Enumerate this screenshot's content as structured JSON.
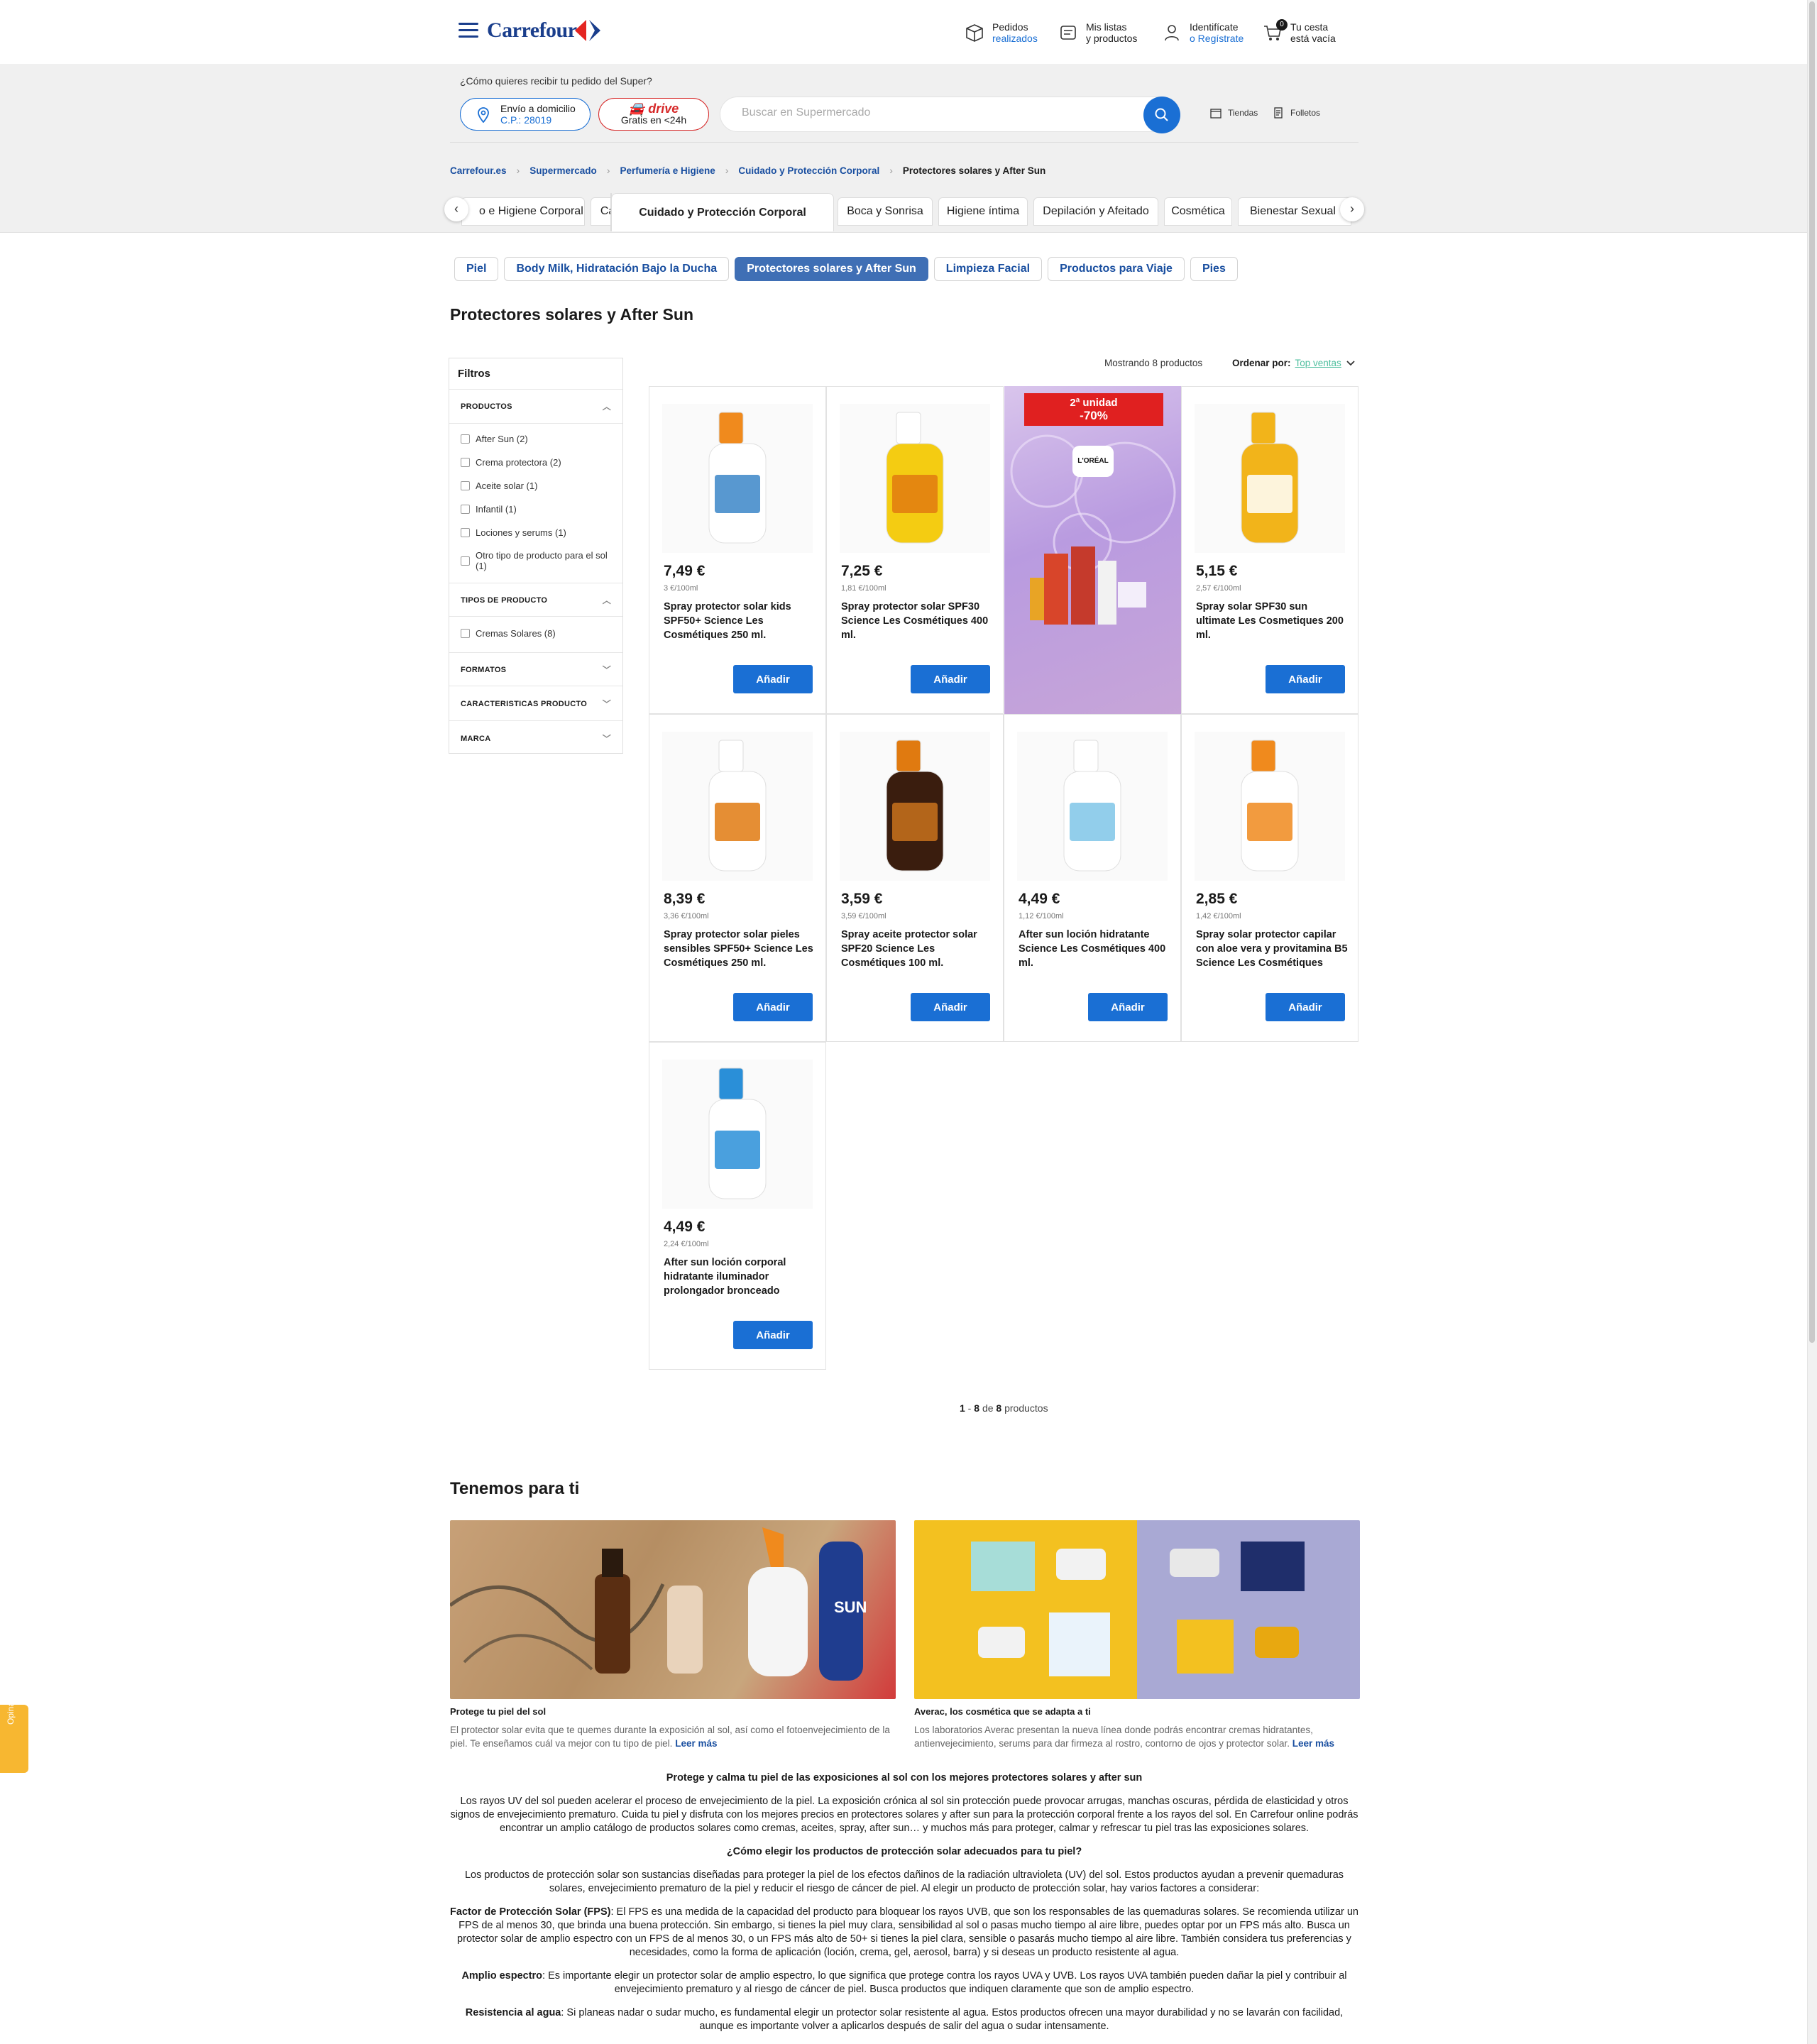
{
  "header": {
    "logo": "Carrefour",
    "orders": {
      "line1": "Pedidos",
      "line2": "realizados"
    },
    "lists": {
      "line1": "Mis listas",
      "line2": "y productos"
    },
    "account": {
      "line1": "Identifícate",
      "line2": "o Regístrate"
    },
    "cart": {
      "count": "0",
      "line1": "Tu cesta",
      "line2": "está vacía"
    }
  },
  "delivery": {
    "question": "¿Cómo quieres recibir tu pedido del Super?",
    "home_label": "Envío a domicilio",
    "home_cp": "C.P.: 28019",
    "drive_label": "drive",
    "drive_sub": "Gratis en <24h"
  },
  "search": {
    "placeholder": "Buscar en Supermercado"
  },
  "links": {
    "stores": "Tiendas",
    "leaflets": "Folletos"
  },
  "breadcrumb": [
    "Carrefour.es",
    "Supermercado",
    "Perfumería e Higiene",
    "Cuidado y Protección Corporal",
    "Protectores solares y After Sun"
  ],
  "category_tabs": [
    "o e Higiene Corporal",
    "Cabello",
    "Cuidado y Protección Corporal",
    "Boca y Sonrisa",
    "Higiene íntima",
    "Depilación y Afeitado",
    "Cosmética",
    "Bienestar Sexual"
  ],
  "subcategories": [
    "Piel",
    "Body Milk, Hidratación Bajo la Ducha",
    "Protectores solares y After Sun",
    "Limpieza Facial",
    "Productos para Viaje",
    "Pies"
  ],
  "page_title": "Protectores solares y After Sun",
  "filters": {
    "title": "Filtros",
    "sections": [
      {
        "name": "PRODUCTOS",
        "options": [
          "After Sun (2)",
          "Crema protectora (2)",
          "Aceite solar (1)",
          "Infantil (1)",
          "Lociones y serums (1)",
          "Otro tipo de producto para el sol (1)"
        ]
      },
      {
        "name": "TIPOS DE PRODUCTO",
        "options": [
          "Cremas Solares (8)"
        ]
      },
      {
        "name": "FORMATOS"
      },
      {
        "name": "CARACTERISTICAS PRODUCTO"
      },
      {
        "name": "MARCA"
      }
    ]
  },
  "results": {
    "showing": "Mostrando 8 productos",
    "order_label": "Ordenar por:",
    "order_value": "Top ventas"
  },
  "products": [
    {
      "price": "7,49 €",
      "unit": "3 €/100ml",
      "name": "Spray protector solar kids SPF50+ Science Les Cosmétiques 250 ml.",
      "button": "Añadir",
      "cap": "#f08a1d",
      "body": "#ffffff",
      "label": "#3b86c8"
    },
    {
      "price": "7,25 €",
      "unit": "1,81 €/100ml",
      "name": "Spray protector solar SPF30 Science Les Cosmétiques 400 ml.",
      "button": "Añadir",
      "cap": "#ffffff",
      "body": "#f4cc12",
      "label": "#e07a10"
    },
    {
      "promo": true,
      "badge_line1": "2ª unidad",
      "badge_line2": "-70%",
      "brand": "L'ORÉAL"
    },
    {
      "price": "5,15 €",
      "unit": "2,57 €/100ml",
      "name": "Spray solar SPF30 sun ultimate Les Cosmetiques 200 ml.",
      "button": "Añadir",
      "cap": "#f2b41a",
      "body": "#f2b41a",
      "label": "#ffffff"
    },
    {
      "price": "8,39 €",
      "unit": "3,36 €/100ml",
      "name": "Spray protector solar pieles sensibles SPF50+ Science Les Cosmétiques 250 ml.",
      "button": "Añadir",
      "cap": "#ffffff",
      "body": "#ffffff",
      "label": "#e07a10"
    },
    {
      "price": "3,59 €",
      "unit": "3,59 €/100ml",
      "name": "Spray aceite protector solar SPF20 Science Les Cosmétiques 100 ml.",
      "button": "Añadir",
      "cap": "#e07a10",
      "body": "#3a1d0e",
      "label": "#c9721c"
    },
    {
      "price": "4,49 €",
      "unit": "1,12 €/100ml",
      "name": "After sun loción hidratante Science Les Cosmétiques 400 ml.",
      "button": "Añadir",
      "cap": "#ffffff",
      "body": "#ffffff",
      "label": "#7fc6e8"
    },
    {
      "price": "2,85 €",
      "unit": "1,42 €/100ml",
      "name": "Spray solar protector capilar con aloe vera y provitamina B5 Science Les Cosmétiques",
      "button": "Añadir",
      "cap": "#f08a1d",
      "body": "#ffffff",
      "label": "#f08a1d"
    },
    {
      "price": "4,49 €",
      "unit": "2,24 €/100ml",
      "name": "After sun loción corporal hidratante iluminador prolongador bronceado",
      "button": "Añadir",
      "cap": "#2a8fd8",
      "body": "#ffffff",
      "label": "#2a8fd8"
    }
  ],
  "pager": {
    "from": "1",
    "to": "8",
    "of_word": "de",
    "total": "8",
    "suffix": "productos"
  },
  "tenemos": {
    "title": "Tenemos para ti",
    "cards": [
      {
        "title": "Protege tu piel del sol",
        "text": "El protector solar evita que te quemes durante la exposición al sol, así como el fotoenvejecimiento de la piel. Te enseñamos cuál va mejor con tu tipo de piel.",
        "more": "Leer más"
      },
      {
        "title": "Averac, los cosmética que se adapta a ti",
        "text": "Los laboratorios Averac presentan la nueva línea donde podrás encontrar cremas hidratantes, antienvejecimiento, serums para dar firmeza al rostro, contorno de ojos y protector solar.",
        "more": "Leer más"
      }
    ]
  },
  "seo": {
    "h1": "Protege y calma tu piel de las exposiciones al sol con los mejores protectores solares y after sun",
    "p1": "Los rayos UV del sol pueden acelerar el proceso de envejecimiento de la piel. La exposición crónica al sol sin protección puede provocar arrugas, manchas oscuras, pérdida de elasticidad y otros signos de envejecimiento prematuro. Cuida tu piel y disfruta con los mejores precios en protectores solares y after sun para la protección corporal frente a los rayos del sol. En Carrefour online podrás encontrar un amplio catálogo de productos solares como cremas, aceites, spray, after sun… y muchos más para proteger, calmar y refrescar tu piel tras las exposiciones solares.",
    "h2": "¿Cómo elegir los productos de protección solar adecuados para tu piel?",
    "p2": "Los productos de protección solar son sustancias diseñadas para proteger la piel de los efectos dañinos de la radiación ultravioleta (UV) del sol. Estos productos ayudan a prevenir quemaduras solares, envejecimiento prematuro de la piel y reducir el riesgo de cáncer de piel. Al elegir un producto de protección solar, hay varios factores a considerar:",
    "fps_label": "Factor de Protección Solar (FPS)",
    "fps_text": ": El FPS es una medida de la capacidad del producto para bloquear los rayos UVB, que son los responsables de las quemaduras solares. Se recomienda utilizar un FPS de al menos 30, que brinda una buena protección. Sin embargo, si tienes la piel muy clara, sensibilidad al sol o pasas mucho tiempo al aire libre, puedes optar por un FPS más alto. Busca un protector solar de amplio espectro con un FPS de al menos 30, o un FPS más alto de 50+ si tienes la piel clara, sensible o pasarás mucho tiempo al aire libre. También considera tus preferencias y necesidades, como la forma de aplicación (loción, crema, gel, aerosol, barra) y si deseas un producto resistente al agua.",
    "amp_label": "Amplio espectro",
    "amp_text": ": Es importante elegir un protector solar de amplio espectro, lo que significa que protege contra los rayos UVA y UVB. Los rayos UVA también pueden dañar la piel y contribuir al envejecimiento prematuro y al riesgo de cáncer de piel. Busca productos que indiquen claramente que son de amplio espectro.",
    "res_label": "Resistencia al agua",
    "res_text": ": Si planeas nadar o sudar mucho, es fundamental elegir un protector solar resistente al agua. Estos productos ofrecen una mayor durabilidad y no se lavarán con facilidad, aunque es importante volver a aplicarlos después de salir del agua o sudar intensamente."
  },
  "opina": "Opina",
  "colors": {
    "brand_blue": "#1a3e8c",
    "action_blue": "#1a6fd4",
    "drive_red": "#d62828"
  }
}
